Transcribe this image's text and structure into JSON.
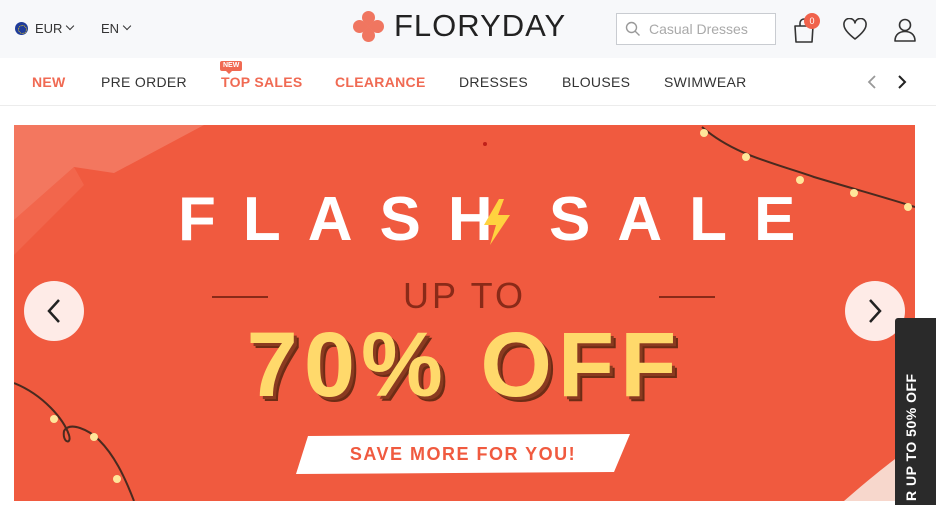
{
  "header": {
    "currency": "EUR",
    "language": "EN",
    "logo_text": "FLORYDAY",
    "search_placeholder": "Casual Dresses",
    "cart_count": "0"
  },
  "nav": {
    "items": [
      {
        "label": "NEW",
        "highlight": true
      },
      {
        "label": "PRE ORDER",
        "highlight": false
      },
      {
        "label": "TOP SALES",
        "highlight": true
      },
      {
        "label": "CLEARANCE",
        "highlight": true
      },
      {
        "label": "DRESSES",
        "highlight": false
      },
      {
        "label": "BLOUSES",
        "highlight": false
      },
      {
        "label": "SWIMWEAR",
        "highlight": false
      }
    ],
    "new_tag": "NEW"
  },
  "banner": {
    "title_left": "FLASH",
    "title_right": "SALE",
    "subtitle": "UP TO",
    "discount": "70% OFF",
    "ribbon": "SAVE MORE FOR YOU!",
    "background_color": "#f05a3f",
    "accent_yellow": "#ffd96b"
  },
  "side_tab": {
    "text": "R UP TO 50% OFF"
  },
  "colors": {
    "brand": "#f06a53",
    "header_bg": "#f7f8fa"
  }
}
